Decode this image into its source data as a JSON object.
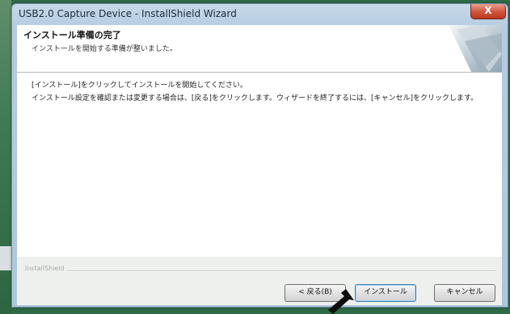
{
  "window": {
    "title": "USB2.0 Capture Device - InstallShield Wizard",
    "close_label": "X"
  },
  "header": {
    "title": "インストール準備の完了",
    "subtitle": "インストールを開始する準備が整いました。"
  },
  "body": {
    "line1": "[インストール]をクリックしてインストールを開始してください。",
    "line2": "インストール設定を確認または変更する場合は、[戻る]をクリックします。ウィザードを終了するには、[キャンセル]をクリックします。"
  },
  "footer": {
    "brand": "InstallShield"
  },
  "buttons": {
    "back": "< 戻る(B)",
    "install": "インストール",
    "cancel": "キャンセル"
  },
  "colors": {
    "desktop": "#2f6b46",
    "window_frame": "#aec6dc",
    "close_button": "#d0533a",
    "default_button_border": "#3c7fb1"
  },
  "icons": {
    "close": "close-icon",
    "cursor": "mouse-pointer-arrow-icon",
    "header_graphic": "installshield-swoosh-icon"
  }
}
